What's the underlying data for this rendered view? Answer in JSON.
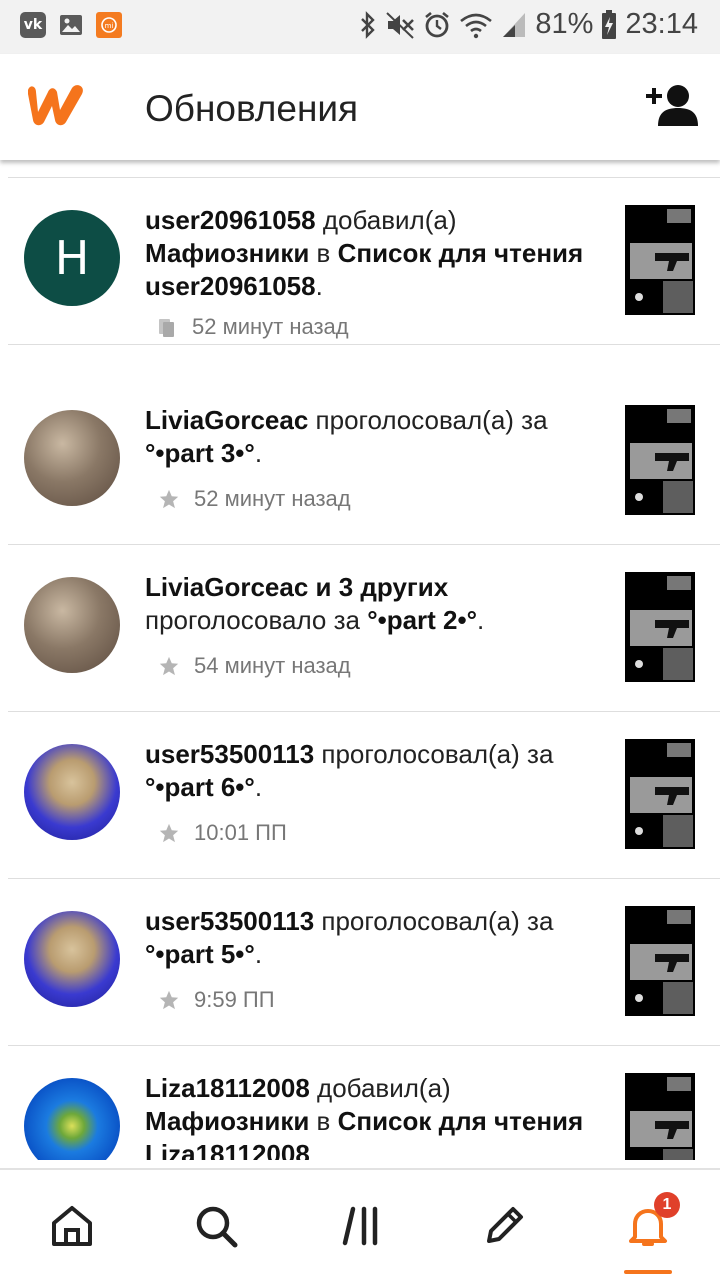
{
  "status_bar": {
    "battery": "81%",
    "time": "23:14"
  },
  "header": {
    "title": "Обновления"
  },
  "feed": [
    {
      "user": "user20961058",
      "action": " добавил(а) ",
      "object": "Мафиозники",
      "connector": " в ",
      "target": "Список для чтения user20961058",
      "suffix": ".",
      "time": "52 минут назад",
      "icon": "library-icon",
      "avatar_letter": "H"
    },
    {
      "user": "LiviaGorceac",
      "action": " проголосовал(а) за ",
      "object": "°•part 3•°",
      "suffix": ".",
      "time": "52 минут назад",
      "icon": "star-icon"
    },
    {
      "user": "LiviaGorceac и 3 других",
      "action": " проголосовало за ",
      "object": "°•part 2•°",
      "suffix": ".",
      "time": "54 минут назад",
      "icon": "star-icon"
    },
    {
      "user": "user53500113",
      "action": " проголосовал(а) за ",
      "object": "°•part 6•°",
      "suffix": ".",
      "time": "10:01 ПП",
      "icon": "star-icon"
    },
    {
      "user": "user53500113",
      "action": " проголосовал(а) за ",
      "object": "°•part 5•°",
      "suffix": ".",
      "time": "9:59 ПП",
      "icon": "star-icon"
    },
    {
      "user": "Liza18112008",
      "action": " добавил(а) ",
      "object": "Мафиозники",
      "connector": " в ",
      "target": "Список для чтения Liza18112008",
      "suffix": "",
      "time": "",
      "icon": ""
    }
  ],
  "bottom_nav": {
    "notification_count": "1"
  },
  "colors": {
    "accent": "#f5741c",
    "badge": "#e0402a",
    "avatar_h": "#0d4d45"
  }
}
